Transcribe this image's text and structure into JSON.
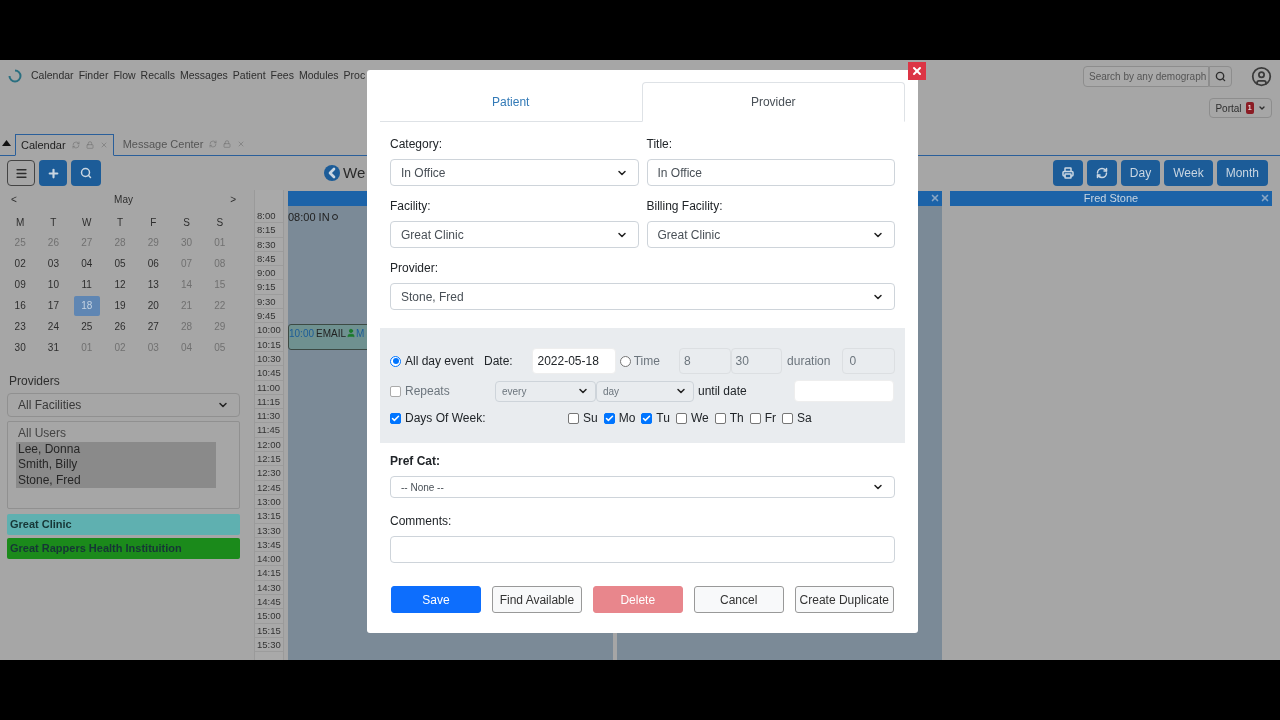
{
  "nav": {
    "menu": [
      "Calendar",
      "Finder",
      "Flow",
      "Recalls",
      "Messages",
      "Patient",
      "Fees",
      "Modules",
      "Proc"
    ],
    "search": {
      "placeholder": "Search by any demograph"
    },
    "portal": {
      "label": "Portal",
      "badge": "1"
    }
  },
  "tabs": [
    {
      "label": "Calendar",
      "selected": true
    },
    {
      "label": "Message Center",
      "selected": false
    }
  ],
  "toolbar": {
    "view_title": "We",
    "views": [
      "Day",
      "Week",
      "Month"
    ]
  },
  "mini_calendar": {
    "prev": "<",
    "month": "May",
    "next": ">",
    "weekdays": [
      "M",
      "T",
      "W",
      "T",
      "F",
      "S",
      "S"
    ],
    "weeks": [
      [
        {
          "day": "25",
          "muted": true,
          "selected": false
        },
        {
          "day": "26",
          "muted": true,
          "selected": false
        },
        {
          "day": "27",
          "muted": true,
          "selected": false
        },
        {
          "day": "28",
          "muted": true,
          "selected": false
        },
        {
          "day": "29",
          "muted": true,
          "selected": false
        },
        {
          "day": "30",
          "muted": true,
          "selected": false
        },
        {
          "day": "01",
          "muted": true,
          "selected": false
        }
      ],
      [
        {
          "day": "02",
          "muted": false,
          "selected": false
        },
        {
          "day": "03",
          "muted": false,
          "selected": false
        },
        {
          "day": "04",
          "muted": false,
          "selected": false
        },
        {
          "day": "05",
          "muted": false,
          "selected": false
        },
        {
          "day": "06",
          "muted": false,
          "selected": false
        },
        {
          "day": "07",
          "muted": true,
          "selected": false
        },
        {
          "day": "08",
          "muted": true,
          "selected": false
        }
      ],
      [
        {
          "day": "09",
          "muted": false,
          "selected": false
        },
        {
          "day": "10",
          "muted": false,
          "selected": false
        },
        {
          "day": "11",
          "muted": false,
          "selected": false
        },
        {
          "day": "12",
          "muted": false,
          "selected": false
        },
        {
          "day": "13",
          "muted": false,
          "selected": false
        },
        {
          "day": "14",
          "muted": true,
          "selected": false
        },
        {
          "day": "15",
          "muted": true,
          "selected": false
        }
      ],
      [
        {
          "day": "16",
          "muted": false,
          "selected": false
        },
        {
          "day": "17",
          "muted": false,
          "selected": false
        },
        {
          "day": "18",
          "muted": false,
          "selected": true
        },
        {
          "day": "19",
          "muted": false,
          "selected": false
        },
        {
          "day": "20",
          "muted": false,
          "selected": false
        },
        {
          "day": "21",
          "muted": true,
          "selected": false
        },
        {
          "day": "22",
          "muted": true,
          "selected": false
        }
      ],
      [
        {
          "day": "23",
          "muted": false,
          "selected": false
        },
        {
          "day": "24",
          "muted": false,
          "selected": false
        },
        {
          "day": "25",
          "muted": false,
          "selected": false
        },
        {
          "day": "26",
          "muted": false,
          "selected": false
        },
        {
          "day": "27",
          "muted": false,
          "selected": false
        },
        {
          "day": "28",
          "muted": true,
          "selected": false
        },
        {
          "day": "29",
          "muted": true,
          "selected": false
        }
      ],
      [
        {
          "day": "30",
          "muted": false,
          "selected": false
        },
        {
          "day": "31",
          "muted": false,
          "selected": false
        },
        {
          "day": "01",
          "muted": true,
          "selected": false
        },
        {
          "day": "02",
          "muted": true,
          "selected": false
        },
        {
          "day": "03",
          "muted": true,
          "selected": false
        },
        {
          "day": "04",
          "muted": true,
          "selected": false
        },
        {
          "day": "05",
          "muted": true,
          "selected": false
        }
      ]
    ]
  },
  "providers": {
    "label": "Providers",
    "facility_select": "All Facilities",
    "users": [
      {
        "name": "All Users",
        "selected": false
      },
      {
        "name": "Lee, Donna",
        "selected": true
      },
      {
        "name": "Smith, Billy",
        "selected": true
      },
      {
        "name": "Stone, Fred",
        "selected": true
      }
    ]
  },
  "facilities": [
    {
      "name": "Great Clinic",
      "color": "#5fb0b0"
    },
    {
      "name": "Great Rappers Health Instituition",
      "color": "#1b8a1b"
    }
  ],
  "schedule": {
    "times": [
      "8:00",
      "8:15",
      "8:30",
      "8:45",
      "9:00",
      "9:15",
      "9:30",
      "9:45",
      "10:00",
      "10:15",
      "10:30",
      "10:45",
      "11:00",
      "11:15",
      "11:30",
      "11:45",
      "12:00",
      "12:15",
      "12:30",
      "12:45",
      "13:00",
      "13:15",
      "13:30",
      "13:45",
      "14:00",
      "14:15",
      "14:30",
      "14:45",
      "15:00",
      "15:15",
      "15:30"
    ],
    "columns": [
      {
        "events": [
          {
            "kind": "plain",
            "time": "08:00",
            "title": "IN"
          },
          {
            "kind": "boxed",
            "time": "10:00",
            "title": "EMAIL",
            "after_icon": "M"
          }
        ]
      },
      {
        "closable": true
      },
      {
        "header": "Fred Stone",
        "closable": true
      }
    ]
  },
  "dialog": {
    "tabs": [
      {
        "label": "Patient",
        "selected": false
      },
      {
        "label": "Provider",
        "selected": true
      }
    ],
    "category": {
      "label": "Category:",
      "value": "In Office"
    },
    "title": {
      "label": "Title:",
      "value": "In Office"
    },
    "facility": {
      "label": "Facility:",
      "value": "Great Clinic"
    },
    "billing_facility": {
      "label": "Billing Facility:",
      "value": "Great Clinic"
    },
    "provider": {
      "label": "Provider:",
      "value": "Stone, Fred"
    },
    "timing": {
      "all_day": {
        "label": "All day event",
        "selected": true
      },
      "date": {
        "label": "Date:",
        "value": "2022-05-18"
      },
      "time": {
        "label": "Time",
        "selected": false
      },
      "hour": {
        "value": "8",
        "disabled": true
      },
      "minute": {
        "value": "30",
        "disabled": true
      },
      "duration": {
        "label": "duration",
        "value": "0",
        "disabled": true
      },
      "repeats": {
        "label": "Repeats",
        "checked": false
      },
      "repeat_every": {
        "value": "every",
        "disabled": true
      },
      "repeat_unit": {
        "value": "day",
        "disabled": true
      },
      "until": {
        "label": "until date"
      },
      "days_of_week": {
        "label": "Days Of Week:",
        "checked": true,
        "days": [
          {
            "label": "Su",
            "checked": false
          },
          {
            "label": "Mo",
            "checked": true
          },
          {
            "label": "Tu",
            "checked": true
          },
          {
            "label": "We",
            "checked": false
          },
          {
            "label": "Th",
            "checked": false
          },
          {
            "label": "Fr",
            "checked": false
          },
          {
            "label": "Sa",
            "checked": false
          }
        ]
      }
    },
    "pref_cat": {
      "label": "Pref Cat:",
      "value": "-- None --"
    },
    "comments": {
      "label": "Comments:"
    },
    "buttons": [
      {
        "label": "Save",
        "kind": "primary"
      },
      {
        "label": "Find Available",
        "kind": "default"
      },
      {
        "label": "Delete",
        "kind": "danger"
      },
      {
        "label": "Cancel",
        "kind": "default"
      },
      {
        "label": "Create Duplicate",
        "kind": "default"
      }
    ]
  }
}
